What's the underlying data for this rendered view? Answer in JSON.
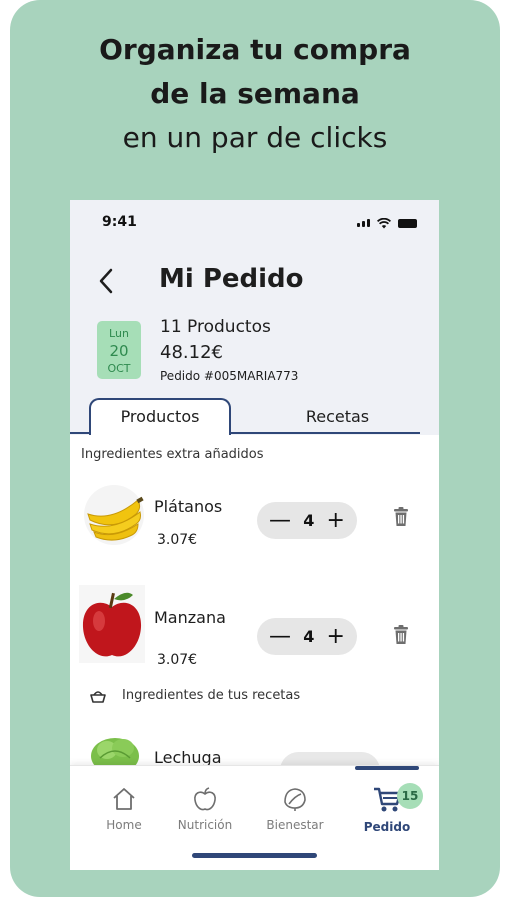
{
  "promo": {
    "line1": "Organiza tu compra",
    "line2": "de la semana",
    "line3": "en un par de clicks"
  },
  "status_bar": {
    "time": "9:41"
  },
  "header": {
    "title": "Mi Pedido"
  },
  "order": {
    "date_day_name": "Lun",
    "date_day": "20",
    "date_month": "OCT",
    "products_count": "11 Productos",
    "total": "48.12€",
    "order_id": "Pedido #005MARIA773"
  },
  "tabs": [
    {
      "label": "Productos",
      "active": true
    },
    {
      "label": "Recetas",
      "active": false
    }
  ],
  "sections": {
    "extra": "Ingredientes extra añadidos",
    "recipes": "Ingredientes de tus recetas"
  },
  "items": [
    {
      "name": "Plátanos",
      "price": "3.07€",
      "qty": "4",
      "image": "banana"
    },
    {
      "name": "Manzana",
      "price": "3.07€",
      "qty": "4",
      "image": "apple"
    },
    {
      "name": "Lechuga",
      "image": "lettuce"
    }
  ],
  "stepper_symbols": {
    "minus": "—",
    "plus": "+"
  },
  "nav": {
    "items": [
      {
        "label": "Home",
        "icon": "home-icon"
      },
      {
        "label": "Nutrición",
        "icon": "apple-icon"
      },
      {
        "label": "Bienestar",
        "icon": "leaf-icon"
      },
      {
        "label": "Pedido",
        "icon": "cart-icon",
        "active": true
      }
    ],
    "cart_badge": "15"
  },
  "colors": {
    "background": "#a8d3bd",
    "accent": "#2f4778",
    "date_badge": "#a6deb7",
    "header_bg": "#eff1f6"
  }
}
